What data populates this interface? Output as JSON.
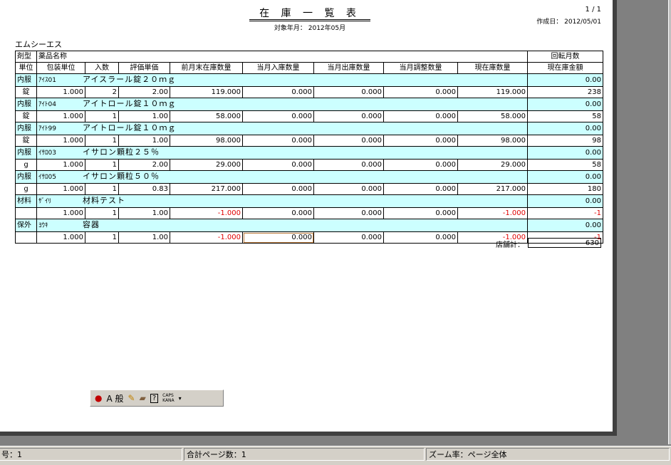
{
  "report": {
    "title": "在 庫 一 覧 表",
    "subtitle": "対象年月： 2012年05月",
    "page": "1 / 1",
    "created": "作成日： 2012/05/01",
    "company": "エムシーエス"
  },
  "headers": {
    "row1": [
      "剤型",
      "薬品名称",
      "回転月数"
    ],
    "row2": [
      "単位",
      "包装単位",
      "入数",
      "評価単価",
      "前月末在庫数量",
      "当月入庫数量",
      "当月出庫数量",
      "当月調整数量",
      "現在庫数量",
      "現在庫金額"
    ]
  },
  "items": [
    {
      "type": "内服",
      "code": "ｱｲｽ01",
      "name": "アイスラール錠２０ｍｇ",
      "turnover": "0.00",
      "unit": "錠",
      "pack": "1.000",
      "qty": "2",
      "price": "2.00",
      "prev": "119.000",
      "in": "0.000",
      "out": "0.000",
      "adj": "0.000",
      "stock": "119.000",
      "amount": "238"
    },
    {
      "type": "内服",
      "code": "ｱｲﾄ04",
      "name": "アイトロール錠１０ｍｇ",
      "turnover": "0.00",
      "unit": "錠",
      "pack": "1.000",
      "qty": "1",
      "price": "1.00",
      "prev": "58.000",
      "in": "0.000",
      "out": "0.000",
      "adj": "0.000",
      "stock": "58.000",
      "amount": "58"
    },
    {
      "type": "内服",
      "code": "ｱｲﾄ99",
      "name": "アイトロール錠１０ｍｇ",
      "turnover": "0.00",
      "unit": "錠",
      "pack": "1.000",
      "qty": "1",
      "price": "1.00",
      "prev": "98.000",
      "in": "0.000",
      "out": "0.000",
      "adj": "0.000",
      "stock": "98.000",
      "amount": "98"
    },
    {
      "type": "内服",
      "code": "ｲｻﾛ03",
      "name": "イサロン顆粒２５％",
      "turnover": "0.00",
      "unit": "g",
      "pack": "1.000",
      "qty": "1",
      "price": "2.00",
      "prev": "29.000",
      "in": "0.000",
      "out": "0.000",
      "adj": "0.000",
      "stock": "29.000",
      "amount": "58"
    },
    {
      "type": "内服",
      "code": "ｲｻﾛ05",
      "name": "イサロン顆粒５０％",
      "turnover": "0.00",
      "unit": "g",
      "pack": "1.000",
      "qty": "1",
      "price": "0.83",
      "prev": "217.000",
      "in": "0.000",
      "out": "0.000",
      "adj": "0.000",
      "stock": "217.000",
      "amount": "180"
    },
    {
      "type": "材料",
      "code": "ｻﾞｲﾘ",
      "name": "材料テスト",
      "turnover": "0.00",
      "unit": "",
      "pack": "1.000",
      "qty": "1",
      "price": "1.00",
      "prev": "-1.000",
      "in": "0.000",
      "out": "0.000",
      "adj": "0.000",
      "stock": "-1.000",
      "amount": "-1"
    },
    {
      "type": "保外",
      "code": "ﾖｳｷ",
      "name": "容器",
      "turnover": "0.00",
      "unit": "",
      "pack": "1.000",
      "qty": "1",
      "price": "1.00",
      "prev": "-1.000",
      "in": "0.000",
      "out": "0.000",
      "adj": "0.000",
      "stock": "-1.000",
      "amount": "-1"
    }
  ],
  "total": {
    "label": "店舗計：",
    "value": "630"
  },
  "ime": {
    "mode": "A 般",
    "caps": "CAPS",
    "kana": "KANA"
  },
  "status": {
    "left": "号：1",
    "pages": "合計ページ数：1",
    "zoom": "ズーム率：ページ全体"
  },
  "colors": {
    "highlight": "#ccffff",
    "negative": "#e00000"
  }
}
